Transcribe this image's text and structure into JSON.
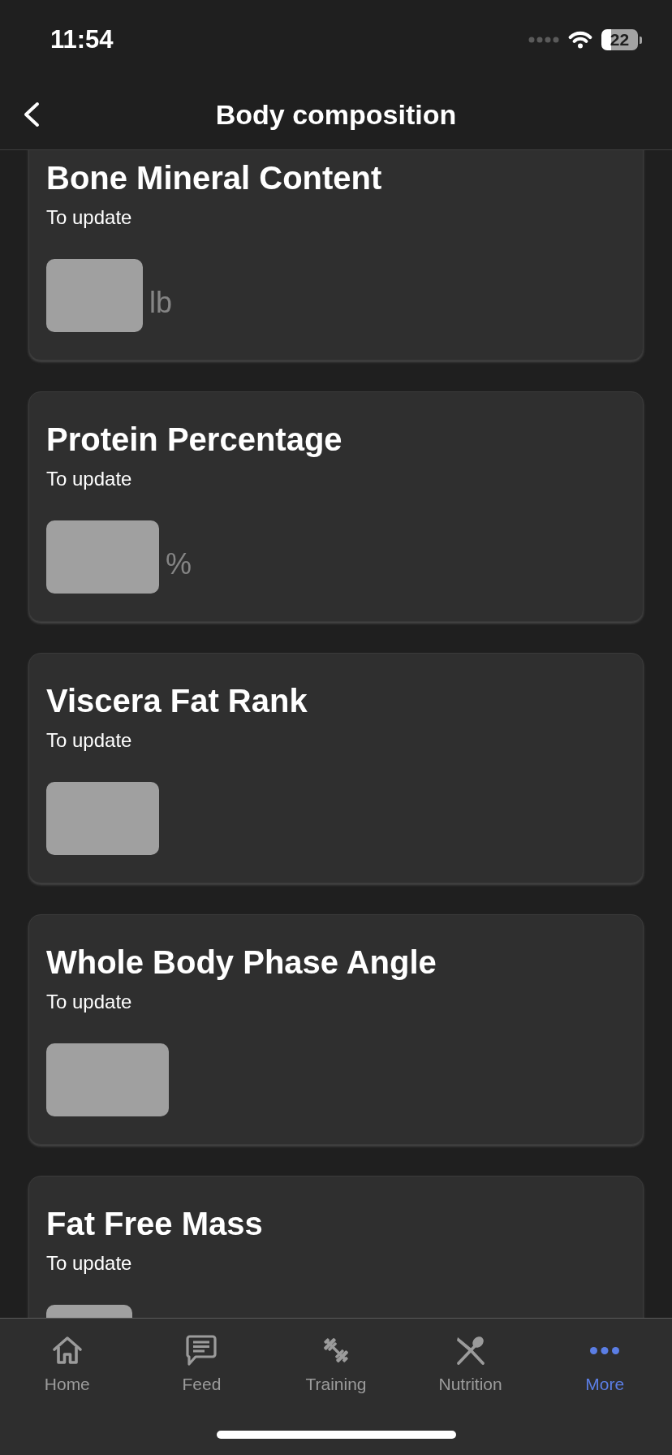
{
  "status_bar": {
    "time": "11:54",
    "battery": "22"
  },
  "header": {
    "title": "Body composition"
  },
  "cards": [
    {
      "title": "Bone Mineral Content",
      "status": "To update",
      "unit": "lb"
    },
    {
      "title": "Protein Percentage",
      "status": "To update",
      "unit": "%"
    },
    {
      "title": "Viscera Fat Rank",
      "status": "To update"
    },
    {
      "title": "Whole Body Phase Angle",
      "status": "To update"
    },
    {
      "title": "Fat Free Mass",
      "status": "To update"
    }
  ],
  "tab_bar": {
    "items": [
      {
        "kind": "home",
        "label": "Home",
        "selected": false
      },
      {
        "kind": "feed",
        "label": "Feed",
        "selected": false
      },
      {
        "kind": "training",
        "label": "Training",
        "selected": false
      },
      {
        "kind": "nutrition",
        "label": "Nutrition",
        "selected": false
      },
      {
        "kind": "more",
        "label": "More",
        "selected": true
      }
    ]
  }
}
